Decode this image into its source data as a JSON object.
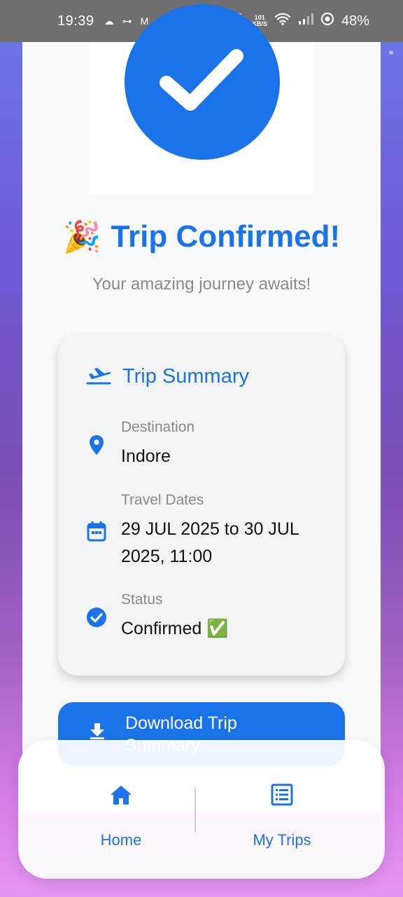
{
  "status_bar": {
    "time": "19:39",
    "speed_value": "101",
    "speed_unit": "KB/S",
    "battery": "48%"
  },
  "confirmation": {
    "emoji": "🎉",
    "title": "Trip Confirmed!",
    "subtitle": "Your amazing journey awaits!"
  },
  "summary": {
    "title": "Trip Summary",
    "destination_label": "Destination",
    "destination_value": "Indore",
    "dates_label": "Travel Dates",
    "dates_value": "29 JUL 2025 to 30 JUL 2025, 11:00",
    "status_label": "Status",
    "status_value": "Confirmed ✅"
  },
  "download_button": {
    "label": "Download Trip Summary"
  },
  "bottom_nav": {
    "items": [
      {
        "label": "Home",
        "icon": "home-icon"
      },
      {
        "label": "My Trips",
        "icon": "list-icon"
      }
    ]
  },
  "colors": {
    "accent": "#1a73e8",
    "card_bg": "#f3f4f6",
    "muted_text": "#8a8a8a"
  }
}
